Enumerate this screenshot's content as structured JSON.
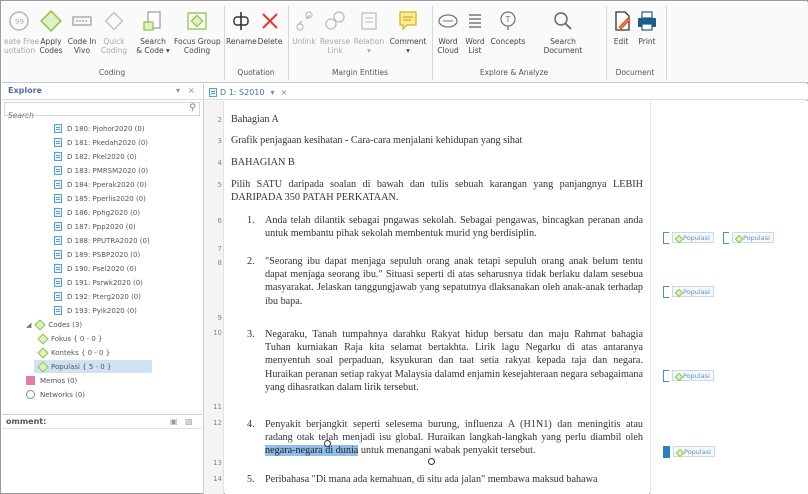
{
  "ribbon": {
    "buttons": [
      {
        "label1": "eate Free",
        "label2": "uotation"
      },
      {
        "label1": "Apply",
        "label2": "Codes"
      },
      {
        "label1": "Code In",
        "label2": "Vivo"
      },
      {
        "label1": "Quick",
        "label2": "Coding"
      },
      {
        "label1": "Search",
        "label2": "& Code"
      },
      {
        "label1": "Focus Group",
        "label2": "Coding"
      },
      {
        "label1": "Rename",
        "label2": ""
      },
      {
        "label1": "Delete",
        "label2": ""
      },
      {
        "label1": "Unlink",
        "label2": ""
      },
      {
        "label1": "Reverse",
        "label2": "Link"
      },
      {
        "label1": "Relation",
        "label2": ""
      },
      {
        "label1": "Comment",
        "label2": ""
      },
      {
        "label1": "Word",
        "label2": "Cloud"
      },
      {
        "label1": "Word",
        "label2": "List"
      },
      {
        "label1": "Concepts",
        "label2": ""
      },
      {
        "label1": "Search",
        "label2": "Document"
      },
      {
        "label1": "Edit",
        "label2": ""
      },
      {
        "label1": "Print",
        "label2": ""
      }
    ],
    "groups": {
      "coding": "Coding",
      "quotation": "Quotation",
      "margin_entities": "Margin Entities",
      "explore_analyze": "Explore & Analyze",
      "document": "Document"
    },
    "dropdown_arrow": "▾"
  },
  "explore": {
    "title": "Explore",
    "search_placeholder": "Search",
    "pin": "▾",
    "close": "×",
    "tree": {
      "documents": [
        "D 180: Pjohor2020 (0)",
        "D 181: Pkedah2020 (0)",
        "D 182: Pkel2020 (0)",
        "D 183: PMRSM2020 (0)",
        "D 184: Pperak2020 (0)",
        "D 185: Pperlis2020 (0)",
        "D 186: Pphg2020 (0)",
        "D 187: Ppp2020 (0)",
        "D 188: PPUTRA2020 (0)",
        "D 189: PSBP2020 (0)",
        "D 190: Psel2020 (0)",
        "D 191: Psrwk2020 (0)",
        "D 192: Pterg2020 (0)",
        "D 193: Pyik2020 (0)"
      ],
      "codes_group": "Codes (3)",
      "codes": [
        "Fokus { 0 - 0 }",
        "Konteks { 0 - 0 }",
        "Populasi { 5 - 0 }"
      ],
      "memos": "Memos (0)",
      "networks": "Networks (0)"
    }
  },
  "comment": {
    "title": "omment:"
  },
  "document": {
    "tab_label": "D 1: S2010",
    "tab_dropdown": "▾",
    "tab_close": "×",
    "line_numbers": [
      "2",
      "3",
      "4",
      "5",
      "6",
      "7",
      "8",
      "9",
      "10",
      "11",
      "12",
      "13",
      "14"
    ],
    "lines": {
      "l2": "Bahagian A",
      "l3": "Grafik penjagaan kesihatan - Cara-cara menjalani kehidupan yang sihat",
      "l4": "BAHAGIAN B",
      "l5": "Pilih SATU daripada soalan di bawah dan tulis sebuah karangan yang panjangnya LEBIH DARIPADA 350 PATAH PERKATAAN.",
      "q1_num": "1.",
      "q1": "Anda telah dilantik sebagai pngawas sekolah. Sebagai pengawas, bincagkan peranan anda untuk membantu pihak sekolah membentuk murid yng berdisiplin.",
      "q2_num": "2.",
      "q2": "\"Seorang ibu dapat menjaga sepuluh orang anak tetapi sepuluh orang anak belum tentu dapat menjaga seorang ibu.\" Situasi seperti di atas seharusnya tidak berlaku dalam sesebua masyarakat. Jelaskan tanggungjawab yang sepatutnya dlaksanakan oleh anak-anak terhadap ibu bapa.",
      "q3_num": "3.",
      "q3": "Negaraku, Tanah tumpahnya darahku Rakyat hidup bersatu dan maju Rahmat bahagia Tuhan kurniakan Raja kita selamat bertakhta. Lirik lagu Negarku di atas antaranya menyentuh soal perpaduan, ksyukuran dan taat setia rakyat kepada taja dan negara. Huraikan peranan setiap rakyat Malaysia dalamd enjamin kesejahteraan negara sebagaimana yang dihasratkan dalam lirik tersebut.",
      "q4_num": "4.",
      "q4_a": "Penyakit berjangkit seperti selesema burung, influenza A (H1N1) dan meningitis atau radang otak telah menjadi isu global. Huraikan langkah-langkah yang perlu diambil oleh ",
      "q4_hl": "negara-negara di dunia",
      "q4_b": " untuk menangani wabak penyakit tersebut.",
      "q5_num": "5.",
      "q5": "Peribahasa \"Di mana ada kemahuan, di situ ada jalan\" membawa maksud bahawa"
    }
  },
  "margin": {
    "tag_label": "Populasi"
  },
  "colors": {
    "accent": "#4a90c8",
    "highlight": "#8ebfe8",
    "code_green": "#8cc63f",
    "explore_title": "#4a6fa5"
  }
}
